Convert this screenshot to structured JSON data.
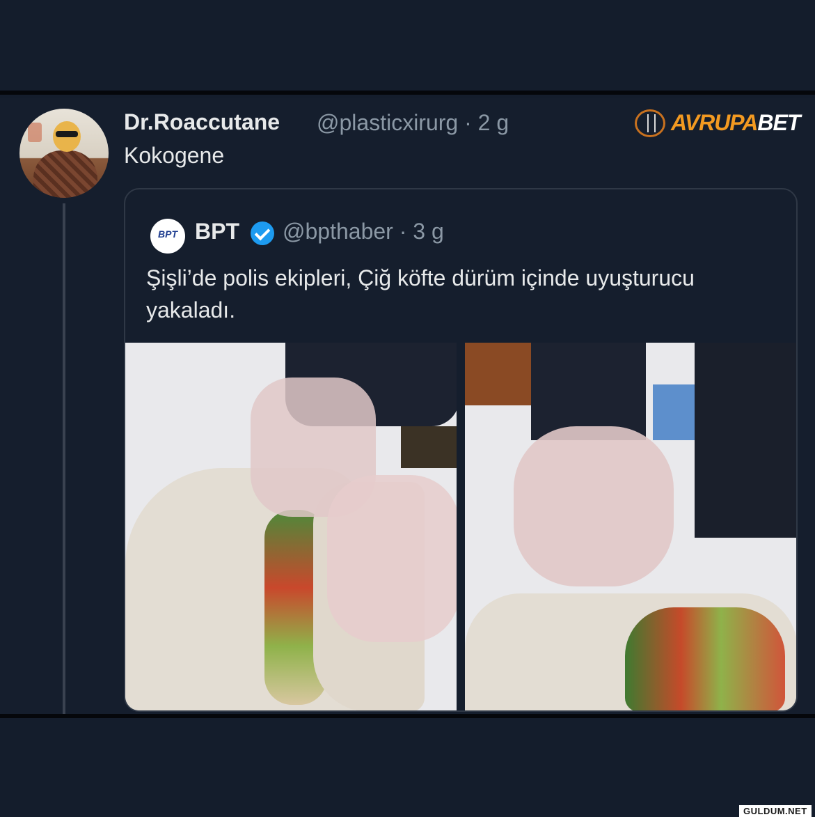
{
  "tweet": {
    "author_name": "Dr.Roaccutane",
    "author_handle": "@plasticxirurg",
    "separator": "·",
    "age": "2 g",
    "text": "Kokogene"
  },
  "brand": {
    "name_part1": "AVRUPA",
    "name_part2": "BET"
  },
  "quoted_tweet": {
    "logo_text": "BPT",
    "author_name": "BPT",
    "verified": true,
    "author_handle": "@bpthaber",
    "separator": "·",
    "age": "3 g",
    "text": "Şişli’de polis ekipleri, Çiğ köfte dürüm içinde uyuşturucu yakaladı."
  },
  "watermark": "GULDUM.NET",
  "colors": {
    "background": "#141d2c",
    "text_primary": "#e7e9ea",
    "text_secondary": "#8b98a5",
    "verified_blue": "#1d9bf0",
    "brand_orange": "#f39a21"
  }
}
